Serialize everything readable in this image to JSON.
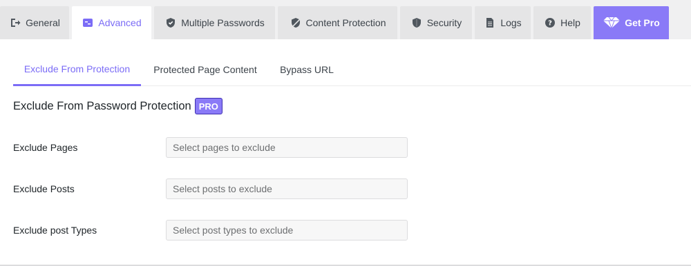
{
  "tabs": [
    {
      "label": "General",
      "icon": "logout-arrow-icon"
    },
    {
      "label": "Advanced",
      "icon": "settings-sliders-icon"
    },
    {
      "label": "Multiple Passwords",
      "icon": "shield-check-icon"
    },
    {
      "label": "Content Protection",
      "icon": "shield-slash-icon"
    },
    {
      "label": "Security",
      "icon": "shield-icon"
    },
    {
      "label": "Logs",
      "icon": "document-icon"
    },
    {
      "label": "Help",
      "icon": "help-circle-icon"
    },
    {
      "label": "Get Pro",
      "icon": "diamond-icon"
    }
  ],
  "active_tab": "Advanced",
  "subtabs": [
    "Exclude From Protection",
    "Protected Page Content",
    "Bypass URL"
  ],
  "active_subtab": "Exclude From Protection",
  "section": {
    "title": "Exclude From Password Protection",
    "badge": "PRO"
  },
  "fields": [
    {
      "label": "Exclude Pages",
      "placeholder": "Select pages to exclude",
      "value": ""
    },
    {
      "label": "Exclude Posts",
      "placeholder": "Select posts to exclude",
      "value": ""
    },
    {
      "label": "Exclude post Types",
      "placeholder": "Select post types to exclude",
      "value": ""
    }
  ],
  "colors": {
    "accent": "#7b6cf6",
    "pro_background": "#8a7af7",
    "tab_background": "#e5e5e6",
    "page_background": "#f0f0f1"
  }
}
